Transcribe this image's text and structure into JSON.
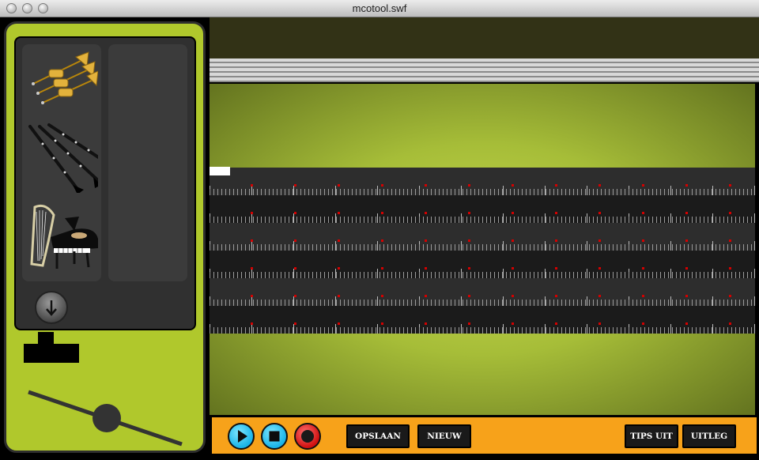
{
  "window": {
    "title": "mcotool.swf"
  },
  "instruments": [
    {
      "name": "trumpets-icon"
    },
    {
      "name": "clarinets-icon"
    },
    {
      "name": "harp-piano-icon"
    }
  ],
  "toolbar": {
    "save_label": "OPSLAAN",
    "new_label": "NIEUW",
    "tips_label": "TIPS UIT",
    "explain_label": "UITLEG"
  },
  "colors": {
    "panel_green": "#b0c82c",
    "toolbar_orange": "#f7a21a",
    "play_blue": "#19b4e8",
    "record_red": "#d01010"
  }
}
